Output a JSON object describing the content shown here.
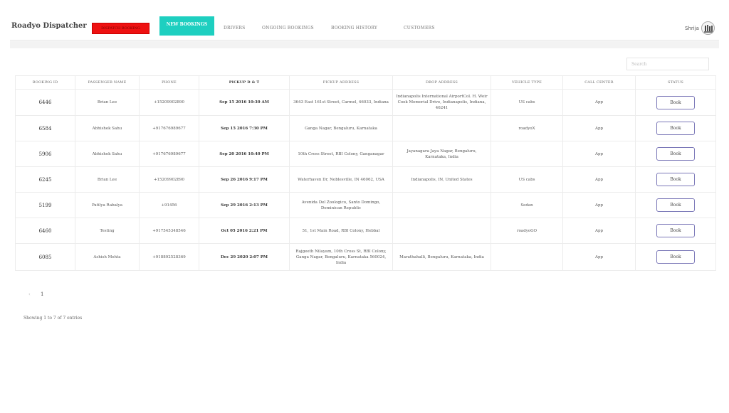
{
  "app": {
    "title": "Roadyo Dispatcher"
  },
  "nav": {
    "red_button": "DISPATCH BOOKING",
    "new_bookings": "NEW BOOKINGS",
    "drivers": "DRIVERS",
    "ongoing": "ONGOING BOOKINGS",
    "history": "BOOKING HISTORY",
    "customers": "CUSTOMERS"
  },
  "user": {
    "name": "Shrija"
  },
  "search": {
    "placeholder": "Search"
  },
  "table": {
    "headers": {
      "booking_id": "BOOKING ID",
      "passenger": "PASSENGER NAME",
      "phone": "PHONE",
      "pickup_dt": "PICKUP D & T",
      "pickup_addr": "PICKUP ADDRESS",
      "drop_addr": "DROP ADDRESS",
      "vehicle": "VEHICLE TYPE",
      "call_center": "CALL CENTER",
      "status": "STATUS"
    },
    "rows": [
      {
        "id": "6446",
        "passenger": "Brian Lee",
        "phone": "+15209902890",
        "pickup_time": "Sep 15 2016 10:30 AM",
        "pickup_address": "3643 East 161st Street, Carmel, 46033, Indiana",
        "drop_address": "Indianapolis International AirportCol. H. Weir Cook Memorial Drive, Indianapolis, Indiana, 46241",
        "vehicle": "US cabs",
        "call_center": "App",
        "action": "Book"
      },
      {
        "id": "6584",
        "passenger": "Abhishek Sahu",
        "phone": "+917676989677",
        "pickup_time": "Sep 15 2016 7:30 PM",
        "pickup_address": "Ganga Nagar, Bengaluru, Karnataka",
        "drop_address": "",
        "vehicle": "roadyoX",
        "call_center": "App",
        "action": "Book"
      },
      {
        "id": "5906",
        "passenger": "Abhishek Sahu",
        "phone": "+917676989677",
        "pickup_time": "Sep 20 2016 10:40 PM",
        "pickup_address": "10th Cross Street, RBI Colony, Ganganagar",
        "drop_address": "Jayanagara Jaya Nagar, Bengaluru, Karnataka, India",
        "vehicle": "",
        "call_center": "App",
        "action": "Book"
      },
      {
        "id": "6245",
        "passenger": "Brian Lee",
        "phone": "+15209902890",
        "pickup_time": "Sep 26 2016 9:17 PM",
        "pickup_address": "Waterhaven Dr, Noblesville, IN 46062, USA",
        "drop_address": "Indianapolis, IN, United States",
        "vehicle": "US cabs",
        "call_center": "App",
        "action": "Book"
      },
      {
        "id": "5199",
        "passenger": "Patilya Rabalya",
        "phone": "+91456",
        "pickup_time": "Sep 29 2016 2:13 PM",
        "pickup_address": "Avenida Del Zoologico, Santo Domingo, Dominican Republic",
        "drop_address": "",
        "vehicle": "Sedan",
        "call_center": "App",
        "action": "Book"
      },
      {
        "id": "6460",
        "passenger": "Testing",
        "phone": "+917545348546",
        "pickup_time": "Oct 05 2016 2:21 PM",
        "pickup_address": "51, 1st Main Road, RBI Colony, Hebbal",
        "drop_address": "",
        "vehicle": "roadyoGO",
        "call_center": "App",
        "action": "Book"
      },
      {
        "id": "6085",
        "passenger": "Ashish Mehta",
        "phone": "+918892528369",
        "pickup_time": "Dec 29 2020 2:07 PM",
        "pickup_address": "Rajgeeth Nilayam, 10th Cross St, RBI Colony, Ganga Nagar, Bengaluru, Karnataka 560024, India",
        "drop_address": "Marathahalli, Bengaluru, Karnataka, India",
        "vehicle": "",
        "call_center": "App",
        "action": "Book"
      }
    ]
  },
  "pagination": {
    "prev": "‹",
    "current": "1"
  },
  "footer": {
    "info": "Showing 1 to 7 of 7 entries"
  }
}
